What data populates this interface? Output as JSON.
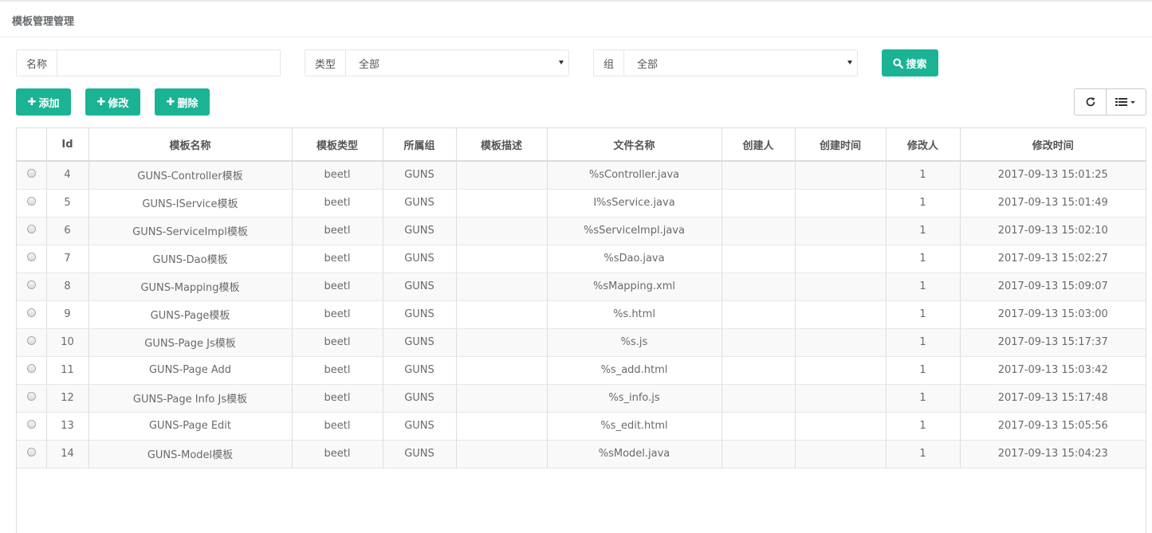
{
  "page": {
    "title": "模板管理管理"
  },
  "search": {
    "name_label": "名称",
    "name_value": "",
    "type_label": "类型",
    "type_value": "全部",
    "group_label": "组",
    "group_value": "全部",
    "search_button": "搜索"
  },
  "toolbar": {
    "add_label": "添加",
    "edit_label": "修改",
    "delete_label": "删除"
  },
  "colors": {
    "accent": "#1ab394"
  },
  "icons": {
    "search": "search-icon",
    "plus": "plus-icon",
    "refresh": "refresh-icon",
    "columns": "list-icon"
  },
  "table": {
    "headers": [
      "Id",
      "模板名称",
      "模板类型",
      "所属组",
      "模板描述",
      "文件名称",
      "创建人",
      "创建时间",
      "修改人",
      "修改时间"
    ],
    "rows": [
      {
        "id": "4",
        "name": "GUNS-Controller模板",
        "type": "beetl",
        "group": "GUNS",
        "desc": "",
        "file": "%sController.java",
        "creator": "",
        "created": "",
        "modifier": "1",
        "modified": "2017-09-13 15:01:25"
      },
      {
        "id": "5",
        "name": "GUNS-IService模板",
        "type": "beetl",
        "group": "GUNS",
        "desc": "",
        "file": "I%sService.java",
        "creator": "",
        "created": "",
        "modifier": "1",
        "modified": "2017-09-13 15:01:49"
      },
      {
        "id": "6",
        "name": "GUNS-ServiceImpl模板",
        "type": "beetl",
        "group": "GUNS",
        "desc": "",
        "file": "%sServiceImpl.java",
        "creator": "",
        "created": "",
        "modifier": "1",
        "modified": "2017-09-13 15:02:10"
      },
      {
        "id": "7",
        "name": "GUNS-Dao模板",
        "type": "beetl",
        "group": "GUNS",
        "desc": "",
        "file": "%sDao.java",
        "creator": "",
        "created": "",
        "modifier": "1",
        "modified": "2017-09-13 15:02:27"
      },
      {
        "id": "8",
        "name": "GUNS-Mapping模板",
        "type": "beetl",
        "group": "GUNS",
        "desc": "",
        "file": "%sMapping.xml",
        "creator": "",
        "created": "",
        "modifier": "1",
        "modified": "2017-09-13 15:09:07"
      },
      {
        "id": "9",
        "name": "GUNS-Page模板",
        "type": "beetl",
        "group": "GUNS",
        "desc": "",
        "file": "%s.html",
        "creator": "",
        "created": "",
        "modifier": "1",
        "modified": "2017-09-13 15:03:00"
      },
      {
        "id": "10",
        "name": "GUNS-Page Js模板",
        "type": "beetl",
        "group": "GUNS",
        "desc": "",
        "file": "%s.js",
        "creator": "",
        "created": "",
        "modifier": "1",
        "modified": "2017-09-13 15:17:37"
      },
      {
        "id": "11",
        "name": "GUNS-Page Add",
        "type": "beetl",
        "group": "GUNS",
        "desc": "",
        "file": "%s_add.html",
        "creator": "",
        "created": "",
        "modifier": "1",
        "modified": "2017-09-13 15:03:42"
      },
      {
        "id": "12",
        "name": "GUNS-Page Info Js模板",
        "type": "beetl",
        "group": "GUNS",
        "desc": "",
        "file": "%s_info.js",
        "creator": "",
        "created": "",
        "modifier": "1",
        "modified": "2017-09-13 15:17:48"
      },
      {
        "id": "13",
        "name": "GUNS-Page Edit",
        "type": "beetl",
        "group": "GUNS",
        "desc": "",
        "file": "%s_edit.html",
        "creator": "",
        "created": "",
        "modifier": "1",
        "modified": "2017-09-13 15:05:56"
      },
      {
        "id": "14",
        "name": "GUNS-Model模板",
        "type": "beetl",
        "group": "GUNS",
        "desc": "",
        "file": "%sModel.java",
        "creator": "",
        "created": "",
        "modifier": "1",
        "modified": "2017-09-13 15:04:23"
      }
    ]
  }
}
